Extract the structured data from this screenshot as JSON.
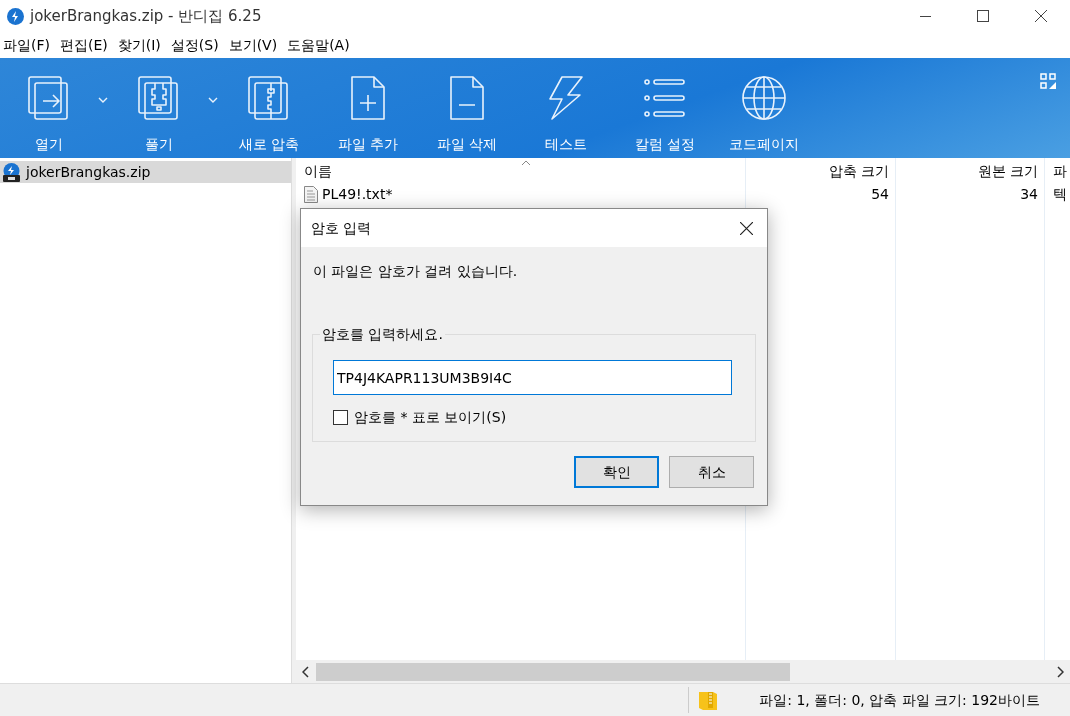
{
  "window": {
    "title": "jokerBrangkas.zip - 반디집 6.25"
  },
  "menu": [
    "파일(F)",
    "편집(E)",
    "찾기(I)",
    "설정(S)",
    "보기(V)",
    "도움말(A)"
  ],
  "toolbar": [
    {
      "label": "열기",
      "kind": "open",
      "has_menu": true
    },
    {
      "label": "풀기",
      "kind": "extract",
      "has_menu": true
    },
    {
      "label": "새로 압축",
      "kind": "compress",
      "has_menu": false
    },
    {
      "label": "파일 추가",
      "kind": "add",
      "has_menu": false
    },
    {
      "label": "파일 삭제",
      "kind": "delete",
      "has_menu": false
    },
    {
      "label": "테스트",
      "kind": "test",
      "has_menu": false
    },
    {
      "label": "칼럼 설정",
      "kind": "columns",
      "has_menu": false
    },
    {
      "label": "코드페이지",
      "kind": "codepage",
      "has_menu": false
    }
  ],
  "tree": {
    "items": [
      {
        "label": "jokerBrangkas.zip",
        "selected": true
      }
    ]
  },
  "file_list": {
    "columns": [
      {
        "label": "이름",
        "sorted": true
      },
      {
        "label": "압축 크기",
        "sorted": false
      },
      {
        "label": "원본 크기",
        "sorted": false
      },
      {
        "label": "파",
        "sorted": false
      }
    ],
    "rows": [
      {
        "cells": [
          "PL49!.txt*",
          "54",
          "34",
          "텍"
        ]
      }
    ]
  },
  "dialog": {
    "title": "암호 입력",
    "message": "이 파일은 암호가 걸려 있습니다.",
    "group_label": "암호를 입력하세요.",
    "password": "TP4J4KAPR113UM3B9I4C",
    "show_as_stars": {
      "label": "암호를 * 표로 보이기(S)",
      "checked": false
    },
    "buttons": [
      {
        "label": "확인",
        "default": true
      },
      {
        "label": "취소",
        "default": false
      }
    ]
  },
  "status_bar": {
    "text": "파일: 1, 폴더: 0, 압축 파일 크기: 192바이트"
  }
}
